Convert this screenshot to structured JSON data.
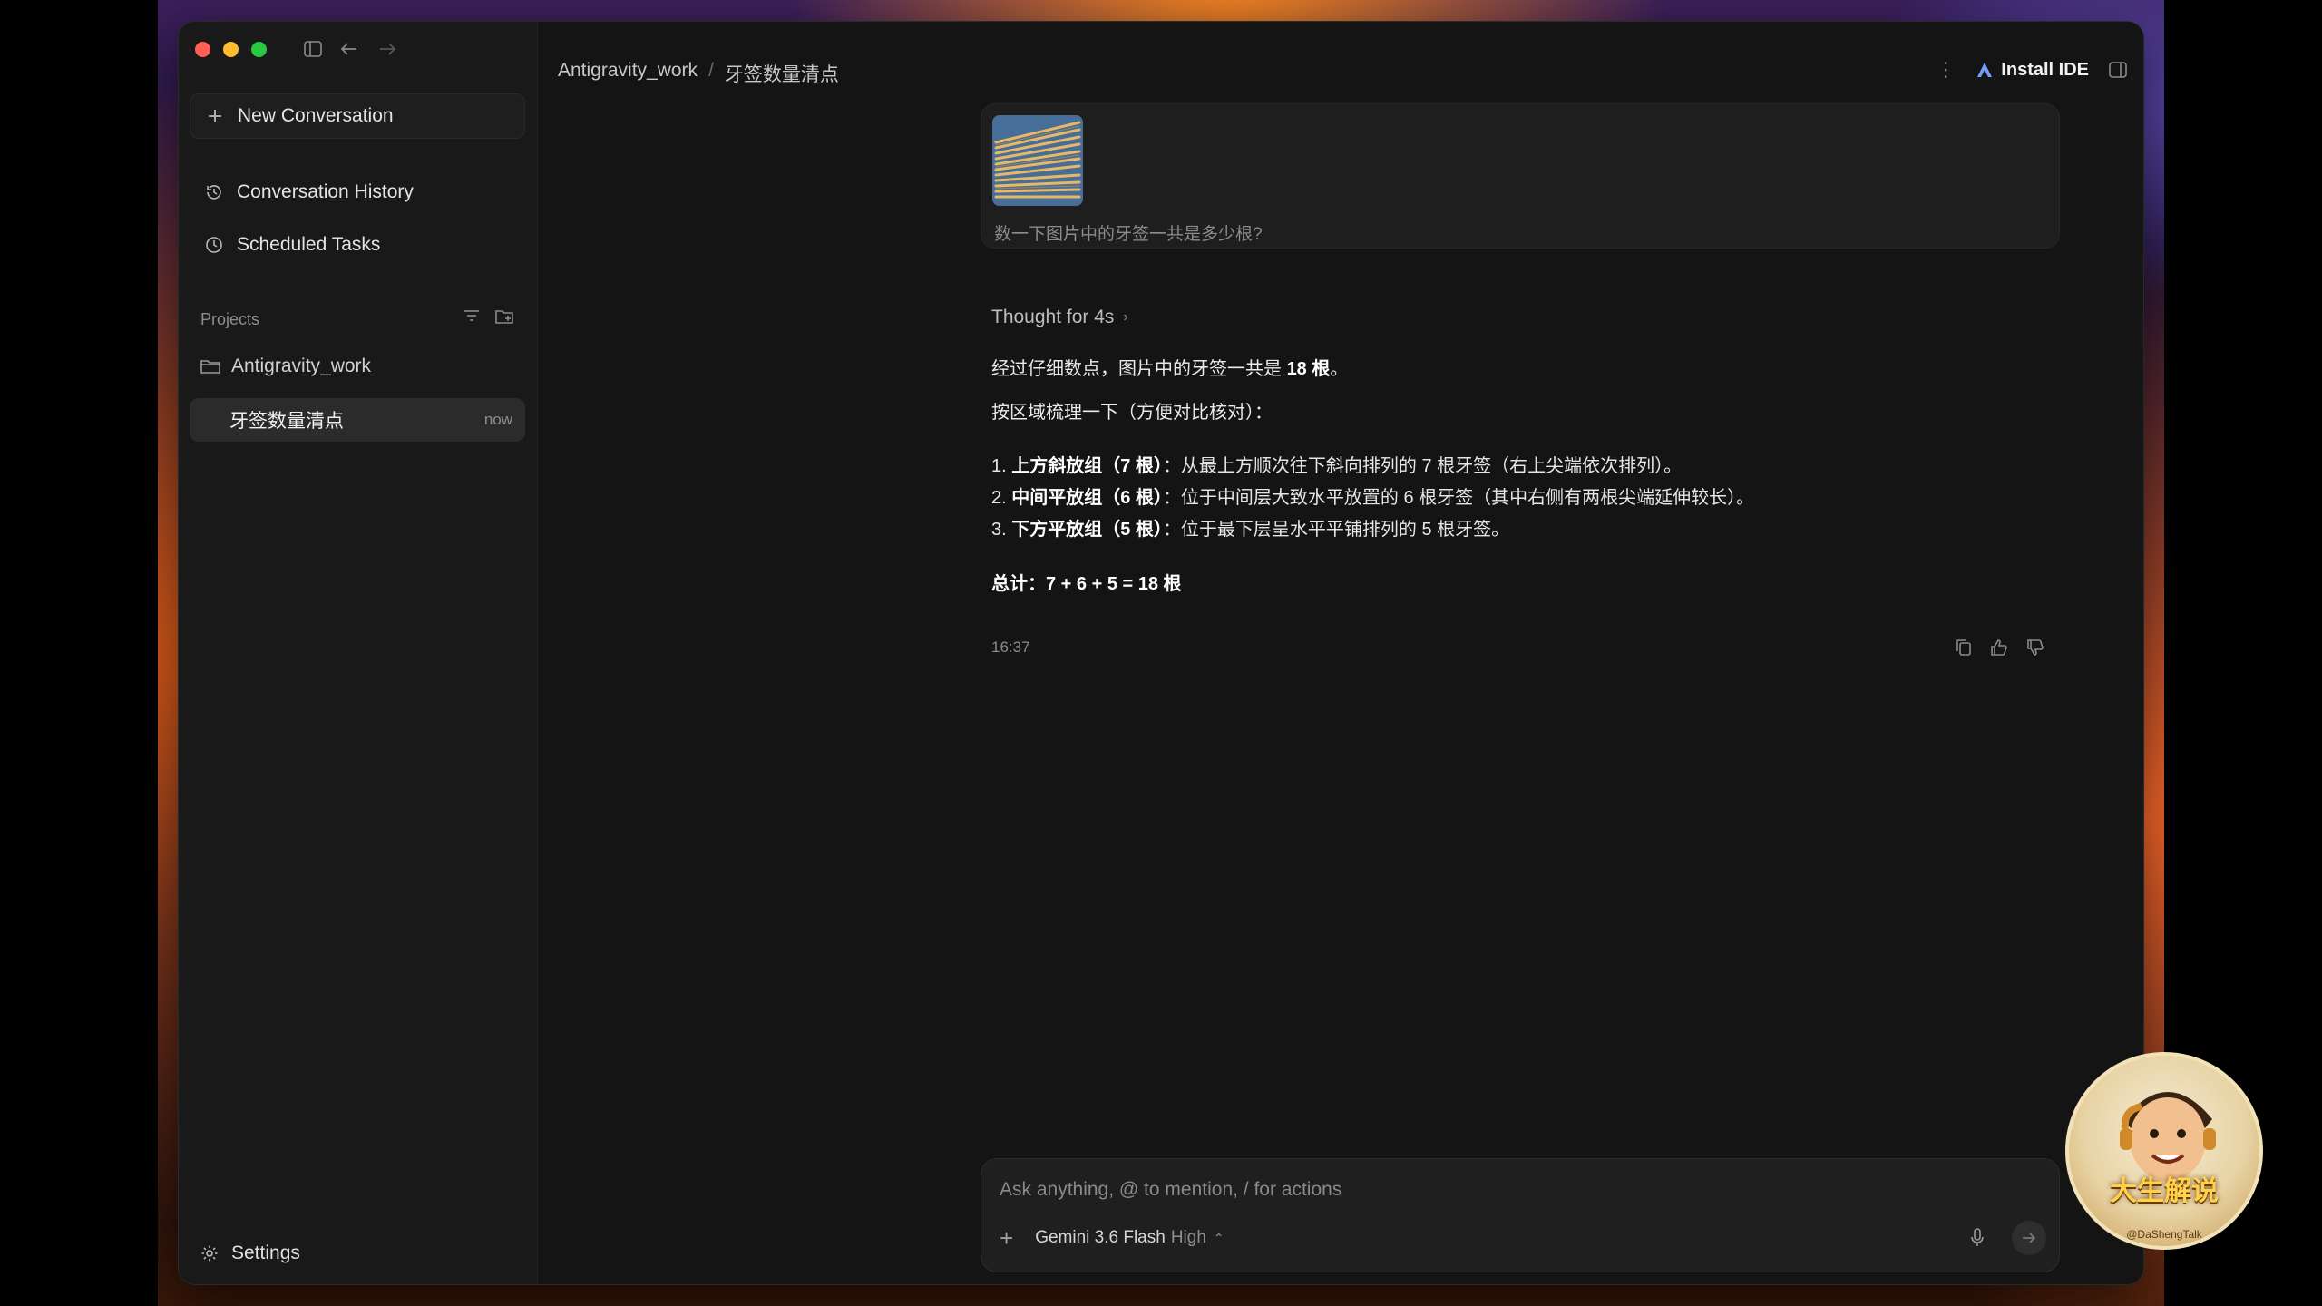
{
  "sidebar": {
    "new_conversation": "New Conversation",
    "conversation_history": "Conversation History",
    "scheduled_tasks": "Scheduled Tasks",
    "projects_label": "Projects",
    "project_folder": "Antigravity_work",
    "active_item": {
      "label": "牙签数量清点",
      "time": "now"
    },
    "settings": "Settings"
  },
  "header": {
    "breadcrumb": [
      "Antigravity_work",
      "牙签数量清点"
    ],
    "install_ide": "Install IDE"
  },
  "user_message": {
    "text": "数一下图片中的牙签一共是多少根?"
  },
  "response": {
    "thought": "Thought for 4s",
    "summary_prefix": "经过仔细数点，图片中的牙签一共是 ",
    "summary_bold": "18 根",
    "summary_suffix": "。",
    "intro": "按区域梳理一下（方便对比核对）：",
    "items": [
      {
        "num": "1.",
        "bold": "上方斜放组（7 根）",
        "text": "：从最上方顺次往下斜向排列的 7 根牙签（右上尖端依次排列）。"
      },
      {
        "num": "2.",
        "bold": "中间平放组（6 根）",
        "text": "：位于中间层大致水平放置的 6 根牙签（其中右侧有两根尖端延伸较长）。"
      },
      {
        "num": "3.",
        "bold": "下方平放组（5 根）",
        "text": "：位于最下层呈水平平铺排列的 5 根牙签。"
      }
    ],
    "total": "总计：7 + 6 + 5 = 18 根",
    "time": "16:37"
  },
  "composer": {
    "placeholder": "Ask anything, @ to mention, / for actions",
    "model": "Gemini 3.6 Flash",
    "level": "High"
  },
  "watermark": {
    "title": "大生解说",
    "handle": "@DaShengTalk"
  },
  "colors": {
    "window_bg": "#151515",
    "sidebar_bg": "#191919",
    "selected_item": "#2b2b2b",
    "traffic_red": "#ff5f57",
    "traffic_yellow": "#febc2e",
    "traffic_green": "#28c840"
  }
}
